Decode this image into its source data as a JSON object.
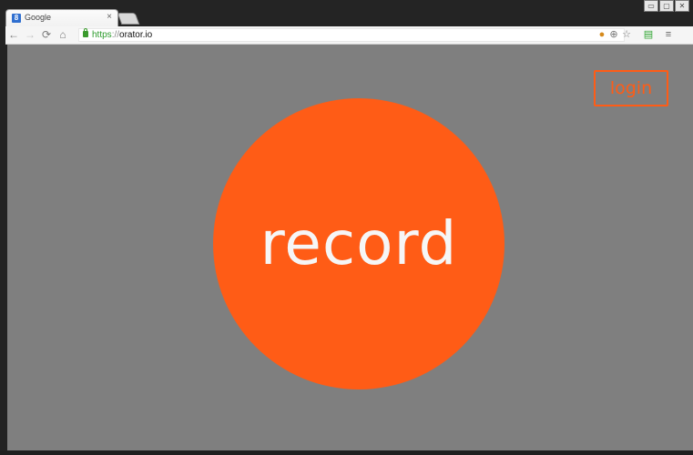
{
  "browser": {
    "tab": {
      "title": "Google",
      "favicon_letter": "8",
      "close_glyph": "×"
    },
    "window_controls": [
      "▭",
      "▢",
      "✕"
    ],
    "toolbar": {
      "back_icon": "arrow-left-icon",
      "forward_icon": "arrow-right-icon",
      "reload_icon": "reload-icon",
      "home_icon": "home-icon",
      "url_scheme": "https",
      "url_sep": "://",
      "url_host": "orator.io",
      "right_icons": [
        "extension-icon",
        "zoom-icon",
        "star-icon",
        "extension-green-icon",
        "menu-icon"
      ]
    }
  },
  "page": {
    "background_color": "#7f7f7f",
    "accent_color": "#ff5c16",
    "record_label": "record",
    "login_label": "login"
  }
}
